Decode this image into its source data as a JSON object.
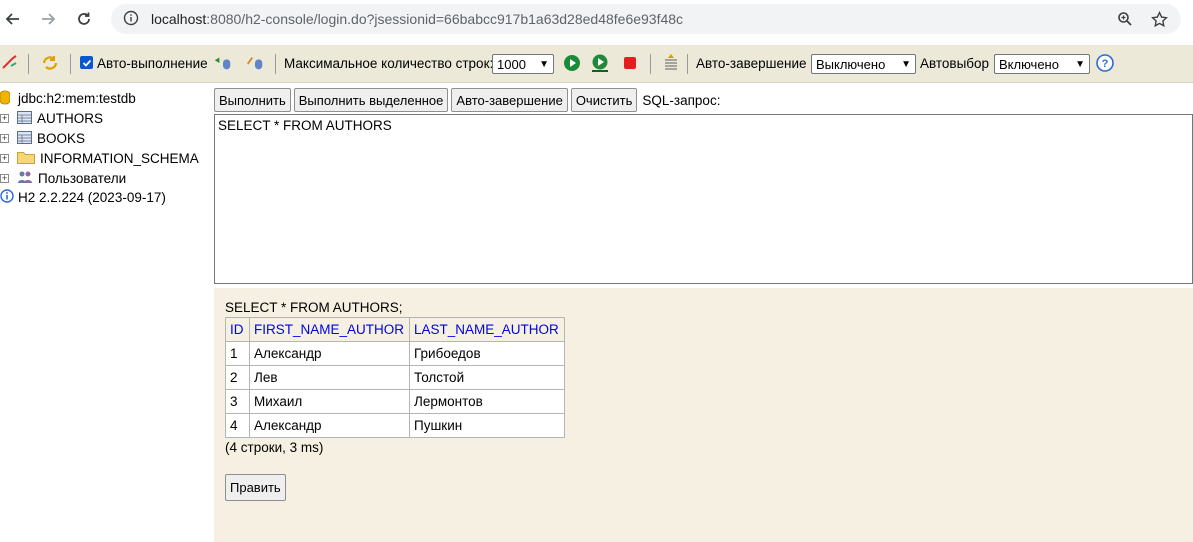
{
  "browser": {
    "url_host": "localhost",
    "url_path": ":8080/h2-console/login.do?jsessionid=66babcc917b1a63d28ed48fe6e93f48c"
  },
  "toolbar": {
    "autocommit_label": "Авто-выполнение",
    "max_rows_label": "Максимальное количество строк:",
    "max_rows_value": "1000",
    "autocomplete_label": "Авто-завершение",
    "autocomplete_value": "Выключено",
    "autoselect_label": "Автовыбор",
    "autoselect_value": "Включено"
  },
  "tree": {
    "connection": "jdbc:h2:mem:testdb",
    "items": [
      {
        "label": "AUTHORS",
        "icon": "table-icon"
      },
      {
        "label": "BOOKS",
        "icon": "table-icon"
      },
      {
        "label": "INFORMATION_SCHEMA",
        "icon": "folder-icon"
      },
      {
        "label": "Пользователи",
        "icon": "users-icon"
      }
    ],
    "version": "H2 2.2.224 (2023-09-17)"
  },
  "query_bar": {
    "run": "Выполнить",
    "run_selected": "Выполнить выделенное",
    "autocomplete": "Авто-завершение",
    "clear": "Очистить",
    "sql_label": "SQL-запрос:"
  },
  "editor": {
    "sql": "SELECT * FROM AUTHORS"
  },
  "result": {
    "query": "SELECT * FROM AUTHORS;",
    "columns": [
      "ID",
      "FIRST_NAME_AUTHOR",
      "LAST_NAME_AUTHOR"
    ],
    "rows": [
      [
        "1",
        "Александр",
        "Грибоедов"
      ],
      [
        "2",
        "Лев",
        "Толстой"
      ],
      [
        "3",
        "Михаил",
        "Лермонтов"
      ],
      [
        "4",
        "Александр",
        "Пушкин"
      ]
    ],
    "count": "(4 строки, 3 ms)",
    "edit_button": "Править"
  }
}
